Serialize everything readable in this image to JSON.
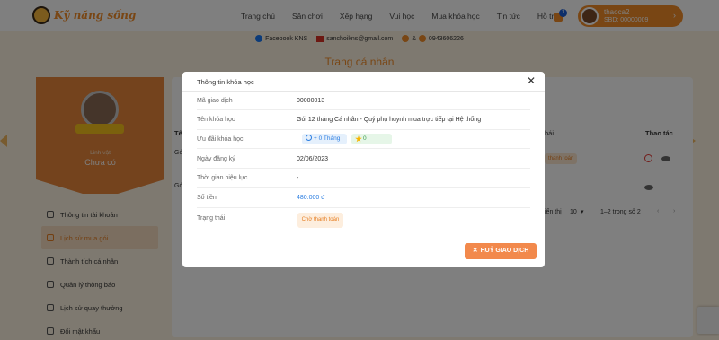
{
  "brand": {
    "logo_text": "Kỹ năng sống"
  },
  "nav": {
    "items": [
      "Trang chủ",
      "Sân chơi",
      "Xếp hạng",
      "Vui học",
      "Mua khóa học",
      "Tin tức",
      "Hỗ trợ"
    ]
  },
  "cart": {
    "badge": "1"
  },
  "user": {
    "name": "thaoca2",
    "sbd": "SBD: 00000009"
  },
  "contact": {
    "facebook": "Facebook KNS",
    "email": "sanchoikns@gmail.com",
    "phone_sep": "&",
    "phone": "0943606226"
  },
  "page": {
    "title": "Trang cá nhân"
  },
  "profile": {
    "rank_label": "Linh vật",
    "rank_value": "Chưa có"
  },
  "sidebar": {
    "items": [
      {
        "label": "Thông tin tài khoản",
        "icon": "user-icon"
      },
      {
        "label": "Lịch sử mua gói",
        "icon": "cart-icon"
      },
      {
        "label": "Thành tích cá nhân",
        "icon": "medal-icon"
      },
      {
        "label": "Quản lý thông báo",
        "icon": "bell-icon"
      },
      {
        "label": "Lịch sử quay thưởng",
        "icon": "history-icon"
      },
      {
        "label": "Đổi mật khẩu",
        "icon": "lock-icon"
      }
    ]
  },
  "table": {
    "col_head_partial": "Tê",
    "col_status_partial": "hái",
    "col_actions": "Thao tác",
    "row1_partial": "Gó",
    "row2_partial": "Gó",
    "row1_status_partial": "thanh toán",
    "pager_show_partial": "iển thị",
    "page_size": "10",
    "page_range": "1–2 trong số 2"
  },
  "modal": {
    "title": "Thông tin khóa học",
    "rows": [
      {
        "label": "Mã giao dịch",
        "value": "00000013"
      },
      {
        "label": "Tên khóa học",
        "value": "Gói 12 tháng Cá nhân - Quý phụ huynh mua trực tiếp tại Hệ thống"
      },
      {
        "label": "Ưu đãi khóa học",
        "value": ""
      },
      {
        "label": "Ngày đăng ký",
        "value": "02/06/2023"
      },
      {
        "label": "Thời gian hiệu lực",
        "value": "-"
      },
      {
        "label": "Số tiền",
        "value": "480.000 đ"
      },
      {
        "label": "Trạng thái",
        "value": ""
      }
    ],
    "bonus_months": "+ 0 Tháng",
    "bonus_stars": "0",
    "status_badge": "Chờ thanh toán",
    "cancel_button": "HUỶ GIAO DỊCH"
  },
  "colors": {
    "accent": "#f28c28",
    "link": "#2a7de1",
    "button": "#f2894c"
  }
}
